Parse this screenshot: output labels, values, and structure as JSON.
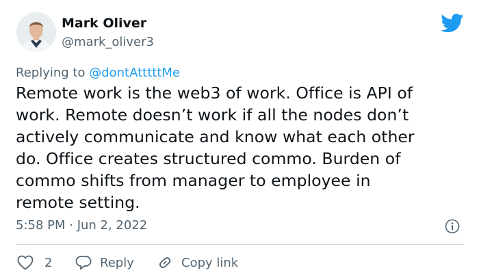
{
  "author": {
    "display_name": "Mark Oliver",
    "handle": "@mark_oliver3"
  },
  "reply_context": {
    "prefix": "Replying to ",
    "mention": "@dontAtttttMe"
  },
  "tweet": {
    "text_lines": [
      "Remote work is the web3 of work. Office is API of",
      "work. Remote doesn’t work if all the nodes don’t",
      "actively communicate and know what each other",
      "do. Office creates structured commo. Burden of",
      "commo shifts from manager to employee in",
      "remote setting."
    ],
    "timestamp": "5:58 PM · Jun 2, 2022"
  },
  "actions": {
    "like_count": "2",
    "reply_label": "Reply",
    "copy_link_label": "Copy link"
  },
  "colors": {
    "brand_blue": "#1d9bf0",
    "secondary_text": "#536471",
    "primary_text": "#0f1419",
    "divider": "#cfd9de"
  },
  "icons": {
    "brand": "twitter-bird-icon",
    "info": "info-icon",
    "like": "heart-icon",
    "reply": "speech-bubble-icon",
    "copy_link": "link-icon"
  }
}
